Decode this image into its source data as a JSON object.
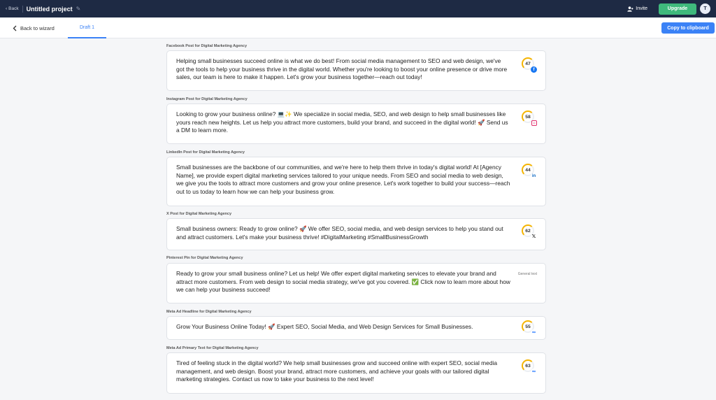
{
  "topbar": {
    "back_label": "Back",
    "project_title": "Untitled project",
    "invite_label": "Invite",
    "upgrade_label": "Upgrade",
    "avatar_initial": "T"
  },
  "subbar": {
    "back_wizard_label": "Back to wizard",
    "draft_tab_label": "Draft 1",
    "copy_label": "Copy to clipboard"
  },
  "posts": [
    {
      "label": "Facebook Post for Digital Marketing Agency",
      "text": "Helping small businesses succeed online is what we do best! From social media management to SEO and web design, we've got the tools to help your business thrive in the digital world. Whether you're looking to boost your online presence or drive more sales, our team is here to make it happen. Let's grow your business together—reach out today!",
      "score": "47",
      "platform_icon": "facebook-icon"
    },
    {
      "label": "Instagram Post for Digital Marketing Agency",
      "text": "Looking to grow your business online? 💻✨ We specialize in social media, SEO, and web design to help small businesses like yours reach new heights. Let us help you attract more customers, build your brand, and succeed in the digital world! 🚀 Send us a DM to learn more.",
      "score": "58",
      "platform_icon": "instagram-icon"
    },
    {
      "label": "LinkedIn Post for Digital Marketing Agency",
      "text": "Small businesses are the backbone of our communities, and we're here to help them thrive in today's digital world! At [Agency Name], we provide expert digital marketing services tailored to your unique needs. From SEO and social media to web design, we give you the tools to attract more customers and grow your online presence. Let's work together to build your success—reach out to us today to learn how we can help your business grow.",
      "score": "44",
      "platform_icon": "linkedin-icon"
    },
    {
      "label": "X Post for Digital Marketing Agency",
      "text": "Small business owners: Ready to grow online? 🚀 We offer SEO, social media, and web design services to help you stand out and attract customers. Let's make your business thrive! #DigitalMarketing #SmallBusinessGrowth",
      "score": "62",
      "platform_icon": "x-icon"
    },
    {
      "label": "Pinterest Pin for Digital Marketing Agency",
      "text": "Ready to grow your small business online? Let us help! We offer expert digital marketing services to elevate your brand and attract more customers. From web design to social media strategy, we've got you covered. ✅ Click now to learn more about how we can help your business succeed!",
      "general_label": "General text"
    },
    {
      "label": "Meta Ad Headline for Digital Marketing Agency",
      "text": "Grow Your Business Online Today! 🚀 Expert SEO, Social Media, and Web Design Services for Small Businesses.",
      "score": "55",
      "platform_icon": "meta-icon"
    },
    {
      "label": "Meta Ad Primary Text for Digital Marketing Agency",
      "text": "Tired of feeling stuck in the digital world? We help small businesses grow and succeed online with expert SEO, social media management, and web design. Boost your brand, attract more customers, and achieve your goals with our tailored digital marketing strategies. Contact us now to take your business to the next level!",
      "score": "63",
      "platform_icon": "meta-icon"
    }
  ],
  "colors": {
    "topbar_bg": "#1e2a44",
    "upgrade_green": "#3fb97c",
    "accent_blue": "#3b82f6",
    "score_ring": "#f5b400"
  }
}
